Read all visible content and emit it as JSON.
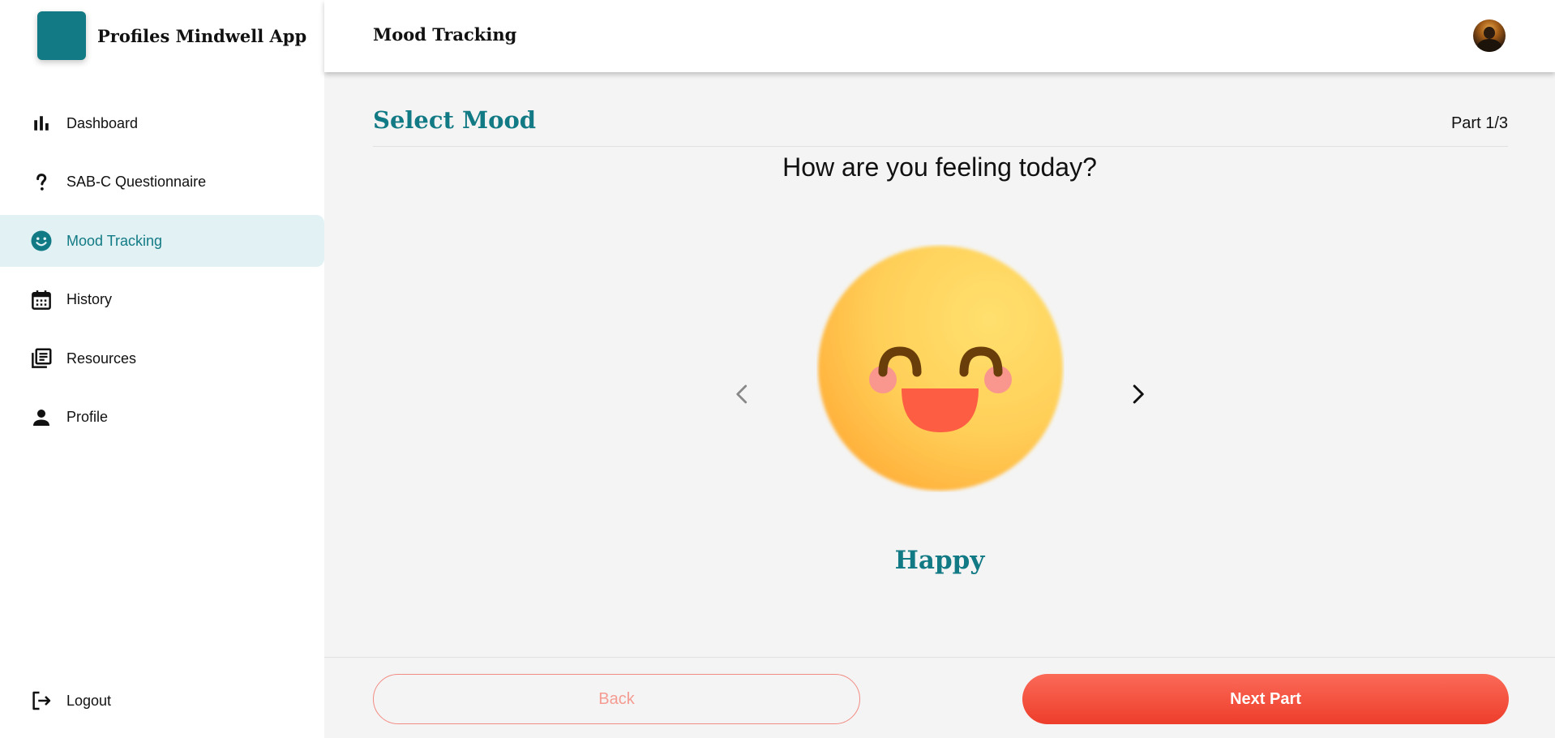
{
  "app": {
    "name": "Profiles Mindwell App",
    "brand_color": "#127a84"
  },
  "sidebar": {
    "items": [
      {
        "label": "Dashboard",
        "icon": "bar-chart-icon",
        "active": false
      },
      {
        "label": "SAB-C Questionnaire",
        "icon": "question-mark-icon",
        "active": false
      },
      {
        "label": "Mood Tracking",
        "icon": "smiley-icon",
        "active": true
      },
      {
        "label": "History",
        "icon": "calendar-icon",
        "active": false
      },
      {
        "label": "Resources",
        "icon": "library-books-icon",
        "active": false
      },
      {
        "label": "Profile",
        "icon": "person-icon",
        "active": false
      }
    ],
    "logout_label": "Logout",
    "logout_icon": "logout-icon"
  },
  "header": {
    "title": "Mood Tracking",
    "avatar_icon": "user-avatar"
  },
  "main": {
    "section_title": "Select Mood",
    "part_indicator": "Part 1/3",
    "question": "How are you feeling today?",
    "selected_mood": "Happy",
    "prev_icon": "chevron-left-icon",
    "next_icon": "chevron-right-icon"
  },
  "footer": {
    "back_label": "Back",
    "next_label": "Next Part"
  },
  "colors": {
    "accent": "#127a84",
    "active_bg": "#e1f1f4",
    "primary_button": "#f04a37",
    "back_outline": "#f28b82"
  }
}
